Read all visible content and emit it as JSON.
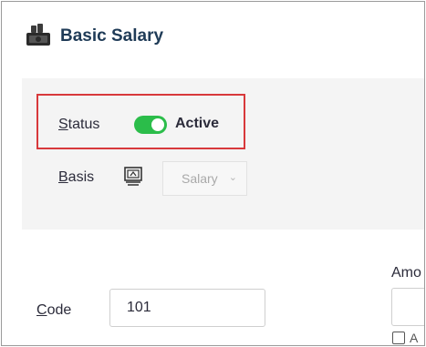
{
  "header": {
    "title": "Basic Salary",
    "icon": "money-stack-icon"
  },
  "status": {
    "label_underlined": "S",
    "label_rest": "tatus",
    "toggle_on": true,
    "toggle_color": "#2bbd4a",
    "value": "Active"
  },
  "basis": {
    "label_underlined": "B",
    "label_rest": "asis",
    "icon": "salary-document-icon",
    "selected": "Salary",
    "chevron": "⌄"
  },
  "code": {
    "label_underlined": "C",
    "label_rest": "ode",
    "value": "101"
  },
  "amount": {
    "label_partial": "Amo",
    "checkbox_label_partial": "A"
  },
  "colors": {
    "highlight": "#d8393b",
    "panel_bg": "#f4f4f4",
    "title": "#1f3b57"
  }
}
